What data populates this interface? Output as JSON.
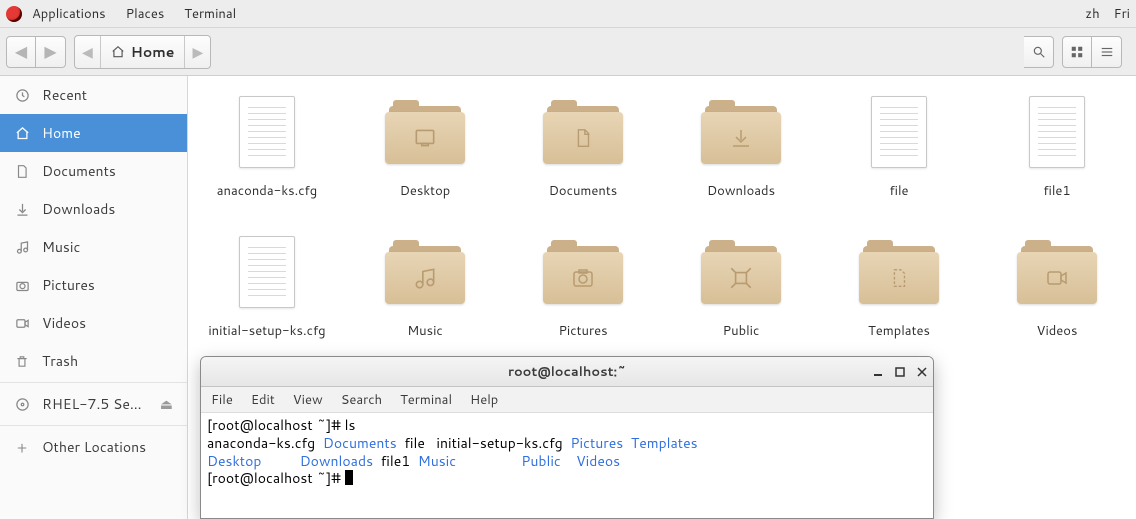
{
  "menubar": {
    "items": [
      "Applications",
      "Places",
      "Terminal"
    ],
    "right": [
      "zh",
      "Fri"
    ]
  },
  "toolbar": {
    "path_current": "Home"
  },
  "sidebar": {
    "items": [
      {
        "label": "Recent"
      },
      {
        "label": "Home"
      },
      {
        "label": "Documents"
      },
      {
        "label": "Downloads"
      },
      {
        "label": "Music"
      },
      {
        "label": "Pictures"
      },
      {
        "label": "Videos"
      },
      {
        "label": "Trash"
      },
      {
        "label": "RHEL-7.5 Se…"
      },
      {
        "label": "Other Locations"
      }
    ]
  },
  "files": {
    "row1": [
      {
        "label": "anaconda-ks.cfg",
        "kind": "doc"
      },
      {
        "label": "Desktop",
        "kind": "folder",
        "glyph": "desktop"
      },
      {
        "label": "Documents",
        "kind": "folder",
        "glyph": "doc"
      },
      {
        "label": "Downloads",
        "kind": "folder",
        "glyph": "download"
      },
      {
        "label": "file",
        "kind": "doc"
      },
      {
        "label": "file1",
        "kind": "doc"
      }
    ],
    "row2": [
      {
        "label": "initial-setup-ks.cfg",
        "kind": "doc"
      },
      {
        "label": "Music",
        "kind": "folder",
        "glyph": "music"
      },
      {
        "label": "Pictures",
        "kind": "folder",
        "glyph": "photo"
      },
      {
        "label": "Public",
        "kind": "folder",
        "glyph": "share"
      },
      {
        "label": "Templates",
        "kind": "folder",
        "glyph": "template"
      },
      {
        "label": "Videos",
        "kind": "folder",
        "glyph": "video"
      }
    ]
  },
  "terminal": {
    "title": "root@localhost:~",
    "menu": [
      "File",
      "Edit",
      "View",
      "Search",
      "Terminal",
      "Help"
    ],
    "prompt1": "[root@localhost ~]# ",
    "cmd1": "ls",
    "line2_plain1": "anaconda-ks.cfg  ",
    "line2_blue1": "Documents",
    "line2_plain2": "  file   initial-setup-ks.cfg  ",
    "line2_blue2": "Pictures",
    "line2_plain3": "  ",
    "line2_blue3": "Templates",
    "line3_blue1": "Desktop",
    "line3_plain1": "          ",
    "line3_blue2": "Downloads",
    "line3_plain2": "  file1  ",
    "line3_blue3": "Music",
    "line3_plain3": "                 ",
    "line3_blue4": "Public",
    "line3_plain4": "    ",
    "line3_blue5": "Videos",
    "prompt2": "[root@localhost ~]# "
  }
}
